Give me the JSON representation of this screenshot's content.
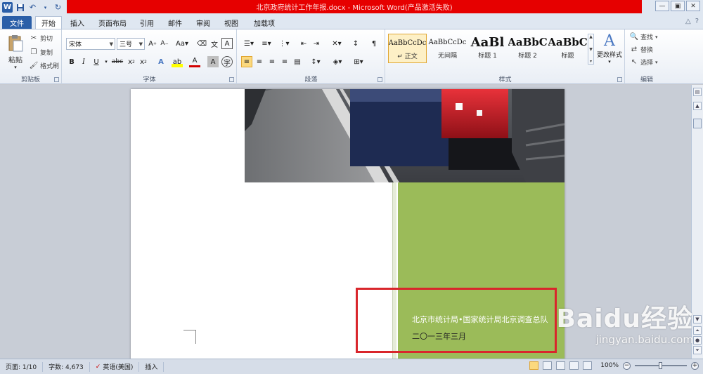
{
  "window": {
    "title": "北京政府统计工作年报.docx - Microsoft Word(产品激活失败)",
    "app_logo": "W"
  },
  "tabs": [
    {
      "label": "文件"
    },
    {
      "label": "开始"
    },
    {
      "label": "插入"
    },
    {
      "label": "页面布局"
    },
    {
      "label": "引用"
    },
    {
      "label": "邮件"
    },
    {
      "label": "审阅"
    },
    {
      "label": "视图"
    },
    {
      "label": "加载项"
    }
  ],
  "ribbon": {
    "clipboard": {
      "paste": "粘贴",
      "cut": "剪切",
      "copy": "复制",
      "format_painter": "格式刷",
      "label": "剪贴板"
    },
    "font": {
      "name": "宋体",
      "size": "三号",
      "label": "字体"
    },
    "paragraph": {
      "label": "段落"
    },
    "styles": {
      "label": "样式",
      "items": [
        {
          "preview": "AaBbCcDc",
          "name": "↵ 正文"
        },
        {
          "preview": "AaBbCcDc",
          "name": "无间隔"
        },
        {
          "preview": "AaBl",
          "name": "标题 1"
        },
        {
          "preview": "AaBbC",
          "name": "标题 2"
        },
        {
          "preview": "AaBbC",
          "name": "标题"
        }
      ],
      "change": "更改样式"
    },
    "editing": {
      "find": "查找",
      "replace": "替换",
      "select": "选择",
      "label": "编辑"
    }
  },
  "document": {
    "org": "北京市统计局•国家统计局北京调查总队",
    "date": "二〇一三年三月"
  },
  "status": {
    "page": "页面: 1/10",
    "words": "字数: 4,673",
    "language": "英语(美国)",
    "mode": "插入",
    "zoom": "100%"
  },
  "watermark": {
    "brand": "Baidu经验",
    "url": "jingyan.baidu.com"
  },
  "colors": {
    "title_red": "#e60000",
    "cover_green": "#9bbb59",
    "highlight_box": "#d9262c",
    "file_tab": "#2b5fa8"
  }
}
